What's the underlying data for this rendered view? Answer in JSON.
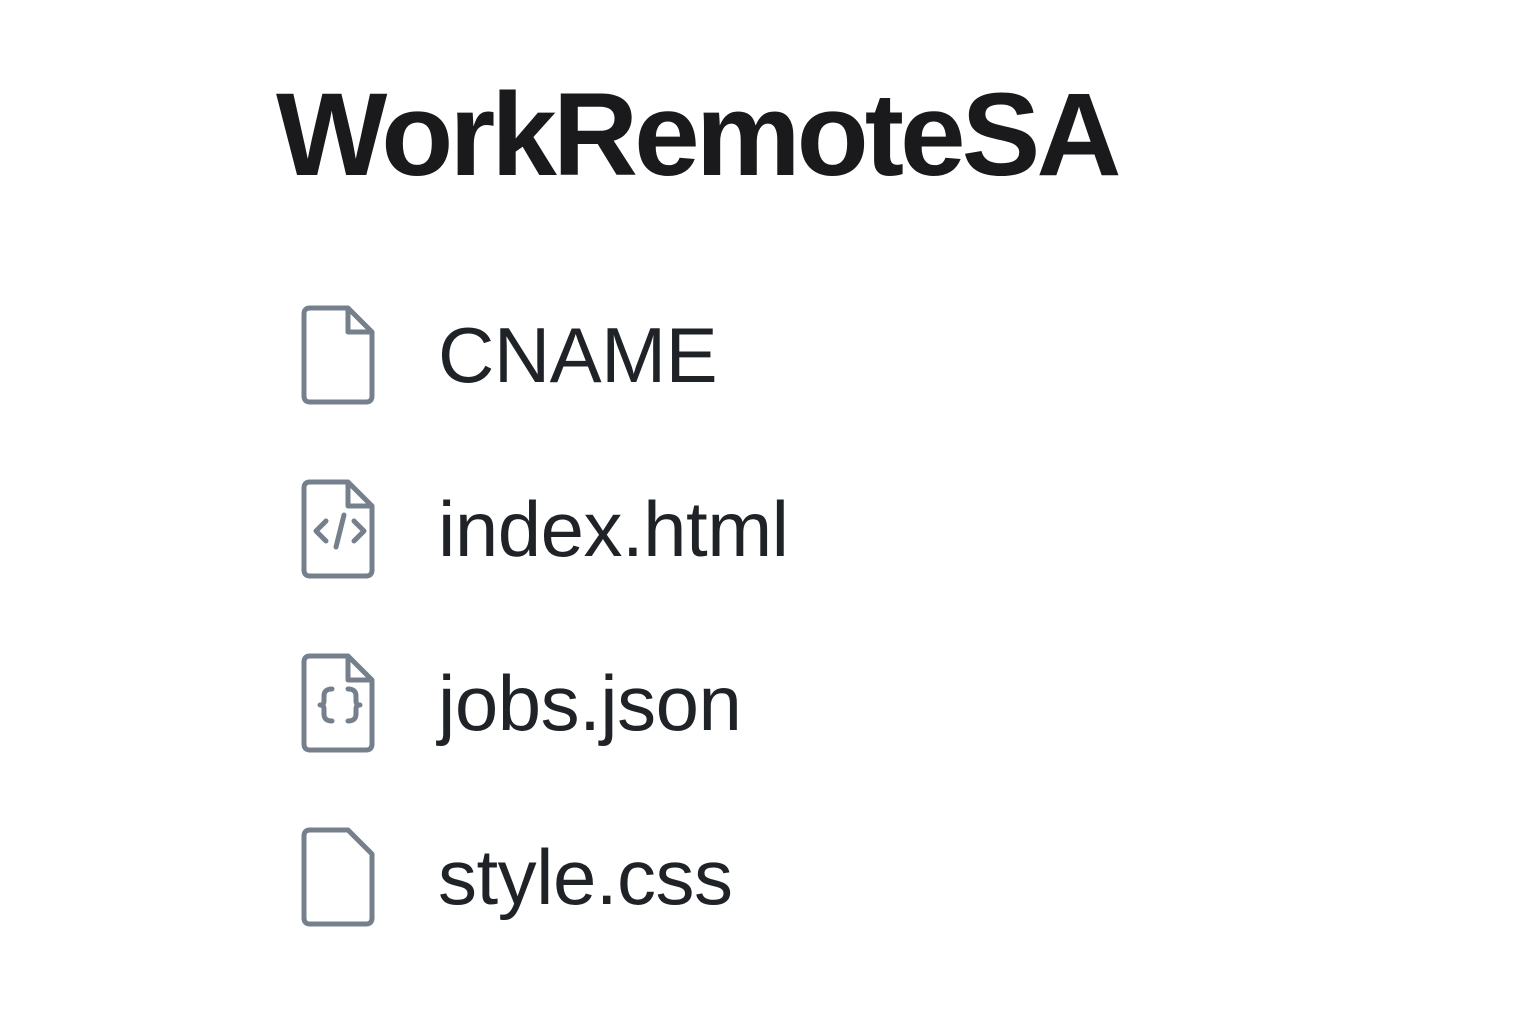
{
  "repo": {
    "title": "WorkRemoteSA"
  },
  "colors": {
    "title": "#1a1a1c",
    "text": "#1f2328",
    "icon": "#76808d",
    "background": "#ffffff"
  },
  "files": [
    {
      "name": "CNAME",
      "icon": "file-icon"
    },
    {
      "name": "index.html",
      "icon": "file-code-icon"
    },
    {
      "name": "jobs.json",
      "icon": "file-json-icon"
    },
    {
      "name": "style.css",
      "icon": "file-icon"
    }
  ]
}
